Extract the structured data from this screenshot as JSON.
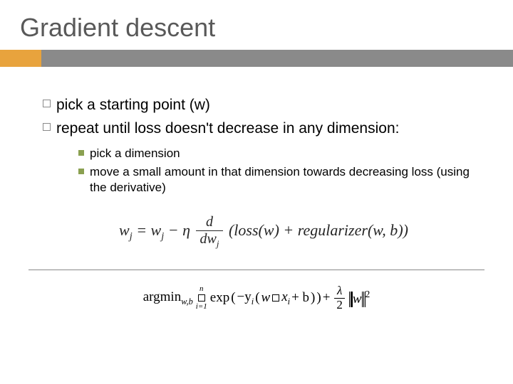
{
  "title": "Gradient descent",
  "bullets": [
    "pick a starting point (w)",
    "repeat until loss doesn't decrease in any dimension:"
  ],
  "subbullets": [
    "pick a dimension",
    "move a small amount in that dimension towards decreasing loss (using the derivative)"
  ],
  "formula1": {
    "lhs_var": "w",
    "lhs_sub": "j",
    "rhs_var": "w",
    "rhs_sub": "j",
    "eta": "η",
    "frac_num": "d",
    "frac_den_d": "dw",
    "frac_den_sub": "j",
    "loss": "loss",
    "w_arg": "w",
    "plus": "+",
    "reg": "regularizer",
    "reg_args": "w, b"
  },
  "formula2": {
    "argmin": "argmin",
    "argmin_sub": "w,b",
    "sum_top": "n",
    "sum_bot": "i=1",
    "exp": "exp",
    "neg_y": "−y",
    "y_sub": "i",
    "w": "w",
    "x": "x",
    "x_sub": "i",
    "plus_b": "+ b",
    "plus": "+",
    "lambda": "λ",
    "two": "2",
    "norm_var": "w",
    "norm_exp": "2"
  }
}
